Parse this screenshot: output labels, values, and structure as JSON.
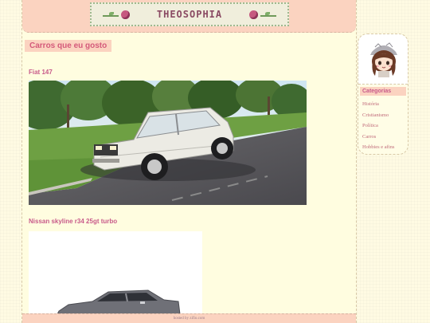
{
  "header": {
    "title": "THEOSOPHIA"
  },
  "post": {
    "title": "Carros que eu gosto",
    "cars": [
      {
        "name": "Fiat 147"
      },
      {
        "name": "Nissan skyline r34 25gt turbo"
      }
    ]
  },
  "sidebar": {
    "categories_title": "Categorias",
    "categories": [
      "História",
      "Cristianismo",
      "Política",
      "Carros",
      "Hobbies e afins"
    ]
  },
  "footer": {
    "text": "hosted by zifio.com"
  },
  "colors": {
    "accent_pink": "#fbd3c0",
    "link": "#c85a8a",
    "background": "#fffde0"
  }
}
